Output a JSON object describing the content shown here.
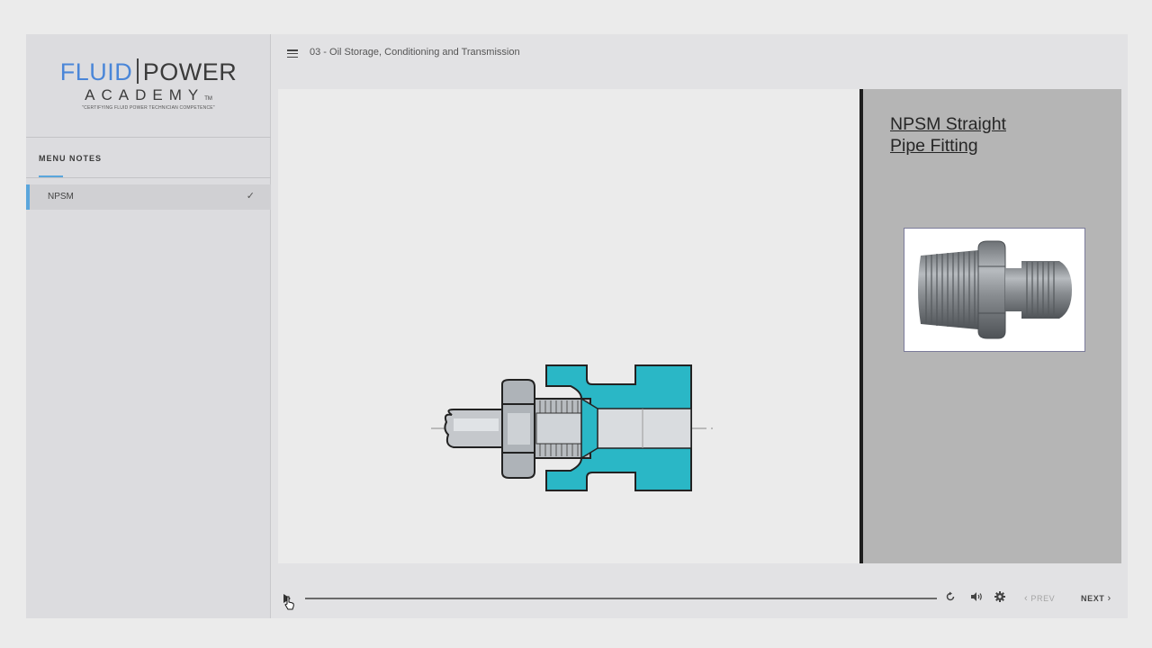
{
  "logo": {
    "word1": "FLUID",
    "word2": "POWER",
    "word3": "ACADEMY",
    "tm": "TM",
    "tagline": "\"CERTIFYING FLUID POWER TECHNICIAN COMPETENCE\""
  },
  "sidebar": {
    "tabs": [
      {
        "label": "MENU",
        "active": true
      },
      {
        "label": "NOTES",
        "active": false
      }
    ],
    "items": [
      {
        "label": "NPSM",
        "completed": true,
        "check_icon": "check-icon"
      }
    ]
  },
  "header": {
    "lesson_title": "03 - Oil Storage, Conditioning and Transmission",
    "menu_icon": "hamburger-icon"
  },
  "slide": {
    "heading": "NPSM Straight \nPipe Fitting",
    "diagram": "npsm-fitting-cutaway",
    "photo": "npsm-fitting-photo"
  },
  "controls": {
    "play_icon": "play-icon",
    "replay_icon": "replay-icon",
    "volume_icon": "volume-icon",
    "settings_icon": "gear-icon",
    "prev_label": "PREV",
    "next_label": "NEXT"
  },
  "colors": {
    "accent": "#5aa6dc",
    "logo_blue": "#4a86d8",
    "fitting_teal": "#2ab7c6",
    "slide_panel": "#b5b5b5"
  }
}
